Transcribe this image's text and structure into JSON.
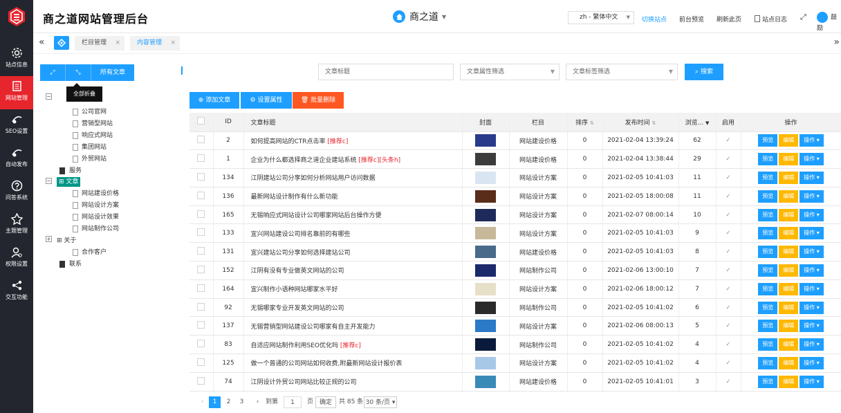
{
  "app": {
    "title": "商之道网站管理后台"
  },
  "sidebar": {
    "items": [
      {
        "label": "站点信息",
        "icon": "gear-icon"
      },
      {
        "label": "网站管理",
        "icon": "document-icon"
      },
      {
        "label": "SEO设置",
        "icon": "seo-icon"
      },
      {
        "label": "自动发布",
        "icon": "seo-icon"
      },
      {
        "label": "问答系统",
        "icon": "question-icon"
      },
      {
        "label": "主题管理",
        "icon": "theme-icon"
      },
      {
        "label": "权限设置",
        "icon": "user-permission-icon"
      },
      {
        "label": "交互功能",
        "icon": "interaction-icon"
      }
    ]
  },
  "header": {
    "brand": "商之道",
    "lang": "zh - 繁体中文",
    "switch": "切换站点",
    "preview": "前台预览",
    "refresh": "刷新此页",
    "log": "站点日志",
    "user": "鼓励"
  },
  "tabs": [
    "栏目管理",
    "内容管理"
  ],
  "tree": {
    "expand_icon": "expand-icon",
    "collapse_icon": "collapse-icon",
    "all": "所有文章",
    "tooltip": "全部折叠",
    "nodes": [
      {
        "label": "公司官网"
      },
      {
        "label": "营销型网站"
      },
      {
        "label": "响应式网站"
      },
      {
        "label": "集团网站"
      },
      {
        "label": "外贸网站"
      },
      {
        "label": "服务"
      },
      {
        "label": "文章"
      },
      {
        "label": "网站建设价格"
      },
      {
        "label": "网站设计方案"
      },
      {
        "label": "网站设计效果"
      },
      {
        "label": "网站制作公司"
      },
      {
        "label": "关于"
      },
      {
        "label": "合作客户"
      },
      {
        "label": "联系"
      }
    ]
  },
  "filters": {
    "title_placeholder": "文章标题",
    "attr": "文章属性筛选",
    "tag": "文章标签筛选",
    "search": "搜索"
  },
  "actions": {
    "add": "添加文章",
    "attr": "设置属性",
    "delete": "批量删除"
  },
  "table": {
    "headers": [
      "ID",
      "文章标题",
      "封面",
      "栏目",
      "排序",
      "发布时间",
      "浏览...",
      "启用",
      "操作"
    ],
    "btn_preview": "预览",
    "btn_edit": "编辑",
    "btn_ops": "操作",
    "rows": [
      {
        "id": "2",
        "title": "如何提高网站的CTR点击率",
        "tag": "[推荐c]",
        "cat": "网站建设价格",
        "sort": "0",
        "time": "2021-02-04 13:39:24",
        "views": "62"
      },
      {
        "id": "1",
        "title": "企业为什么都选择商之道企业建站系统",
        "tag": "[推荐c][头条h]",
        "cat": "网站建设价格",
        "sort": "0",
        "time": "2021-02-04 13:38:44",
        "views": "29"
      },
      {
        "id": "134",
        "title": "江阴建站公司分享如何分析网站用户访问数据",
        "tag": "",
        "cat": "网站设计方案",
        "sort": "0",
        "time": "2021-02-05 10:41:03",
        "views": "11"
      },
      {
        "id": "136",
        "title": "最新网站设计制作有什么新功能",
        "tag": "",
        "cat": "网站设计方案",
        "sort": "0",
        "time": "2021-02-05 18:00:08",
        "views": "11"
      },
      {
        "id": "165",
        "title": "无锡响应式网站设计公司哪家网站后台操作方便",
        "tag": "",
        "cat": "网站设计方案",
        "sort": "0",
        "time": "2021-02-07 08:00:14",
        "views": "10"
      },
      {
        "id": "133",
        "title": "宜兴网站建设公司排名靠前的有哪些",
        "tag": "",
        "cat": "网站设计方案",
        "sort": "0",
        "time": "2021-02-05 10:41:03",
        "views": "9"
      },
      {
        "id": "131",
        "title": "宜兴建站公司分享如何选择建站公司",
        "tag": "",
        "cat": "网站建设价格",
        "sort": "0",
        "time": "2021-02-05 10:41:03",
        "views": "8"
      },
      {
        "id": "152",
        "title": "江阴有没有专业做英文网站的公司",
        "tag": "",
        "cat": "网站制作公司",
        "sort": "0",
        "time": "2021-02-06 13:00:10",
        "views": "7"
      },
      {
        "id": "164",
        "title": "宜兴制作小语种网站哪家水平好",
        "tag": "",
        "cat": "网站设计方案",
        "sort": "0",
        "time": "2021-02-06 18:00:12",
        "views": "7"
      },
      {
        "id": "92",
        "title": "无锡哪家专业开发英文网站的公司",
        "tag": "",
        "cat": "网站制作公司",
        "sort": "0",
        "time": "2021-02-05 10:41:02",
        "views": "6"
      },
      {
        "id": "137",
        "title": "无锡营销型网站建设公司哪家有自主开发能力",
        "tag": "",
        "cat": "网站设计方案",
        "sort": "0",
        "time": "2021-02-06 08:00:13",
        "views": "5"
      },
      {
        "id": "83",
        "title": "自适应网站制作利用SEO优化吗",
        "tag": "[推荐c]",
        "cat": "网站制作公司",
        "sort": "0",
        "time": "2021-02-05 10:41:02",
        "views": "4"
      },
      {
        "id": "125",
        "title": "做一个普通的公司网站如何收费,附最新网站设计报价表",
        "tag": "",
        "cat": "网站设计方案",
        "sort": "0",
        "time": "2021-02-05 10:41:02",
        "views": "4"
      },
      {
        "id": "74",
        "title": "江阴设计外贸公司网站比较正规的公司",
        "tag": "",
        "cat": "网站建设价格",
        "sort": "0",
        "time": "2021-02-05 10:41:01",
        "views": "3"
      }
    ]
  },
  "pager": {
    "pages": [
      "1",
      "2",
      "3"
    ],
    "goto": "到第",
    "page_value": "1",
    "page_unit": "页",
    "confirm": "确定",
    "total": "共 85 条",
    "per_page": "30 条/页"
  }
}
